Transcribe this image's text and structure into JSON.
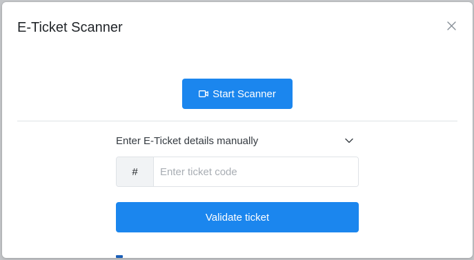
{
  "modal": {
    "title": "E-Ticket Scanner",
    "close_icon": "close-icon"
  },
  "scanner": {
    "start_label": "Start Scanner",
    "icon": "video-camera-icon"
  },
  "manual": {
    "label": "Enter E-Ticket details manually",
    "toggle_icon": "chevron-down-icon",
    "addon_symbol": "#",
    "ticket_input": {
      "value": "",
      "placeholder": "Enter ticket code"
    },
    "validate_label": "Validate ticket"
  },
  "colors": {
    "primary": "#1b86ee",
    "overlay": "#c4c6c9",
    "text": "#212529"
  }
}
